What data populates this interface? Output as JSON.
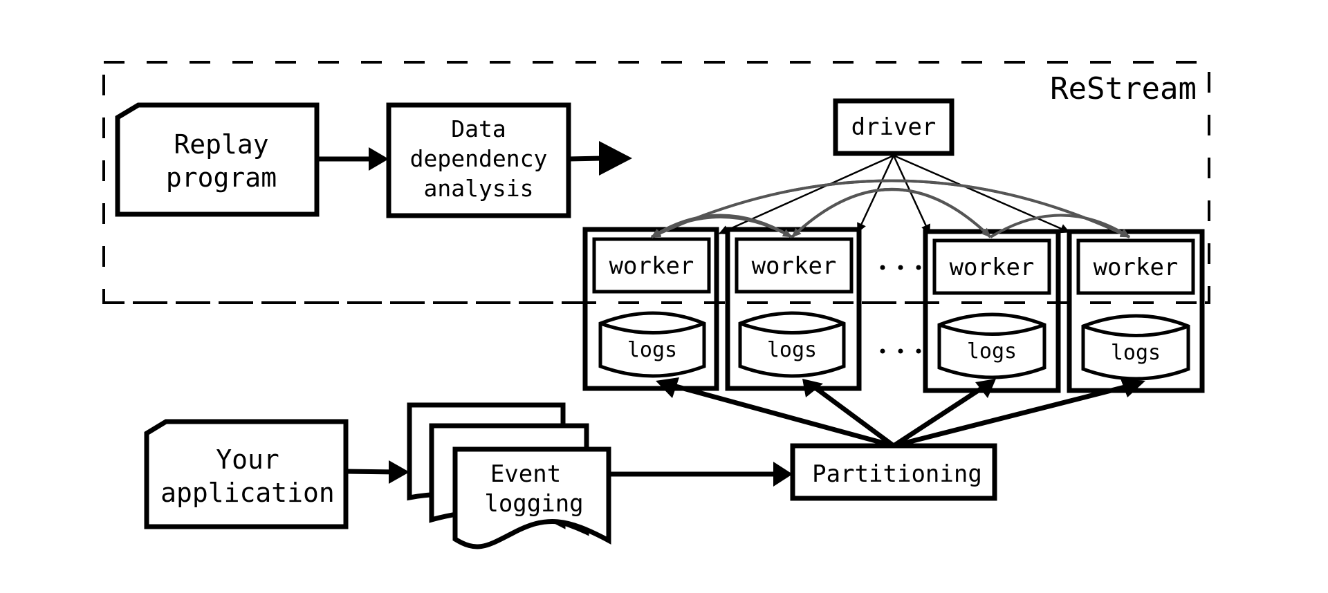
{
  "diagram": {
    "title": "ReStream",
    "replay_program": [
      "Replay",
      "program"
    ],
    "data_dependency": [
      "Data",
      "dependency",
      "analysis"
    ],
    "driver": "driver",
    "workers": [
      "worker",
      "worker",
      "worker",
      "worker"
    ],
    "logs": [
      "logs",
      "logs",
      "logs",
      "logs"
    ],
    "ellipsis": "...",
    "your_application": [
      "Your",
      "application"
    ],
    "event_logging": [
      "Event",
      "logging"
    ],
    "partitioning": "Partitioning",
    "colors": {
      "stroke": "#000000",
      "peer_links": "#555555",
      "background": "#ffffff"
    }
  }
}
